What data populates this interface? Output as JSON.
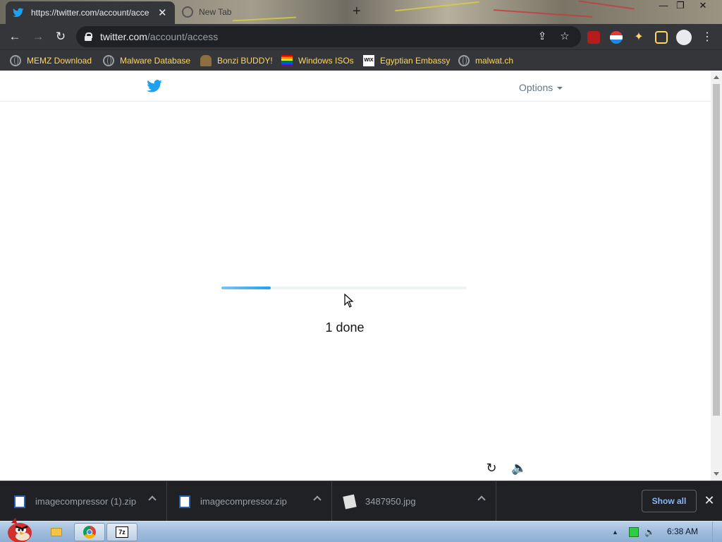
{
  "browser": {
    "tabs": [
      {
        "title": "https://twitter.com/account/acce",
        "active": true
      },
      {
        "title": "New Tab",
        "active": false
      }
    ],
    "url_host": "twitter.com",
    "url_path": "/account/access"
  },
  "bookmarks": [
    {
      "label": "MEMZ Download",
      "icon": "globe-icon"
    },
    {
      "label": "Malware Database",
      "icon": "globe-icon"
    },
    {
      "label": "Bonzi BUDDY!",
      "icon": "bonzi-icon"
    },
    {
      "label": "Windows ISOs",
      "icon": "rainbow-flag-icon"
    },
    {
      "label": "Egyptian Embassy",
      "icon": "wix-icon"
    },
    {
      "label": "malwat.ch",
      "icon": "globe-icon"
    }
  ],
  "page": {
    "options_label": "Options",
    "progress_fraction": 0.2,
    "progress_text": "1 done"
  },
  "downloads": {
    "items": [
      {
        "name": "imagecompressor (1).zip",
        "icon": "zip-file-icon"
      },
      {
        "name": "imagecompressor.zip",
        "icon": "zip-file-icon"
      },
      {
        "name": "3487950.jpg",
        "icon": "image-file-icon"
      }
    ],
    "show_all_label": "Show all"
  },
  "taskbar": {
    "clock": "6:38 AM"
  },
  "colors": {
    "twitter_blue": "#1da1f2",
    "bookmark_text": "#fdd663",
    "chrome_dark": "#35363a"
  }
}
